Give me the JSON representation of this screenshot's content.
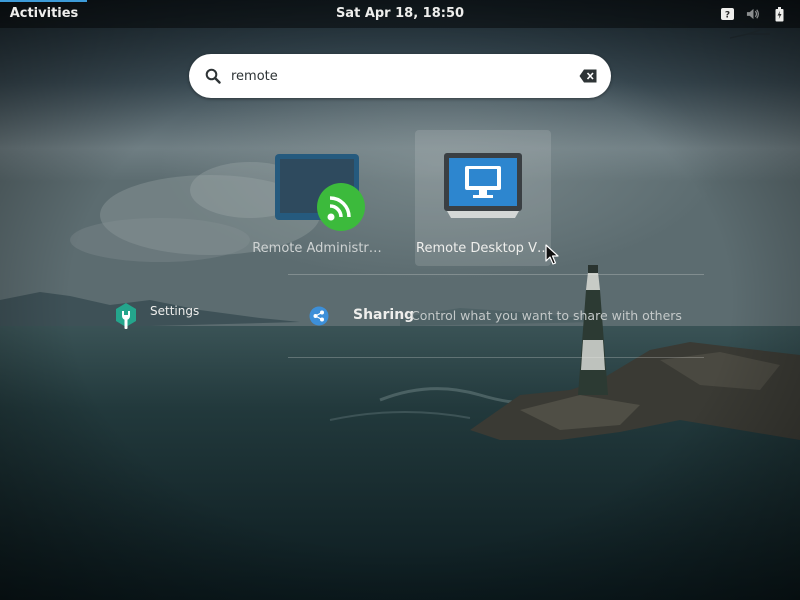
{
  "topbar": {
    "activities_label": "Activities",
    "clock": "Sat Apr 18, 18:50",
    "tray_icons": [
      "help-icon",
      "volume-muted-icon",
      "battery-charging-icon"
    ]
  },
  "search": {
    "value": "remote",
    "icon": "search-icon",
    "clear_icon": "clear-backspace-icon"
  },
  "apps": [
    {
      "label": "Remote Administr…",
      "icon": "remote-administration-icon",
      "selected": false
    },
    {
      "label": "Remote Desktop V…",
      "icon": "remote-desktop-viewer-icon",
      "selected": true
    }
  ],
  "settings_provider": {
    "label": "Settings",
    "icon": "settings-icon",
    "result": {
      "title": "Sharing",
      "description": "Control what you want to share with others",
      "icon": "sharing-icon"
    }
  },
  "colors": {
    "accent": "#3d9bd8",
    "topbar_bg": "rgba(0,0,0,0.45)",
    "search_bg": "#ffffff"
  }
}
